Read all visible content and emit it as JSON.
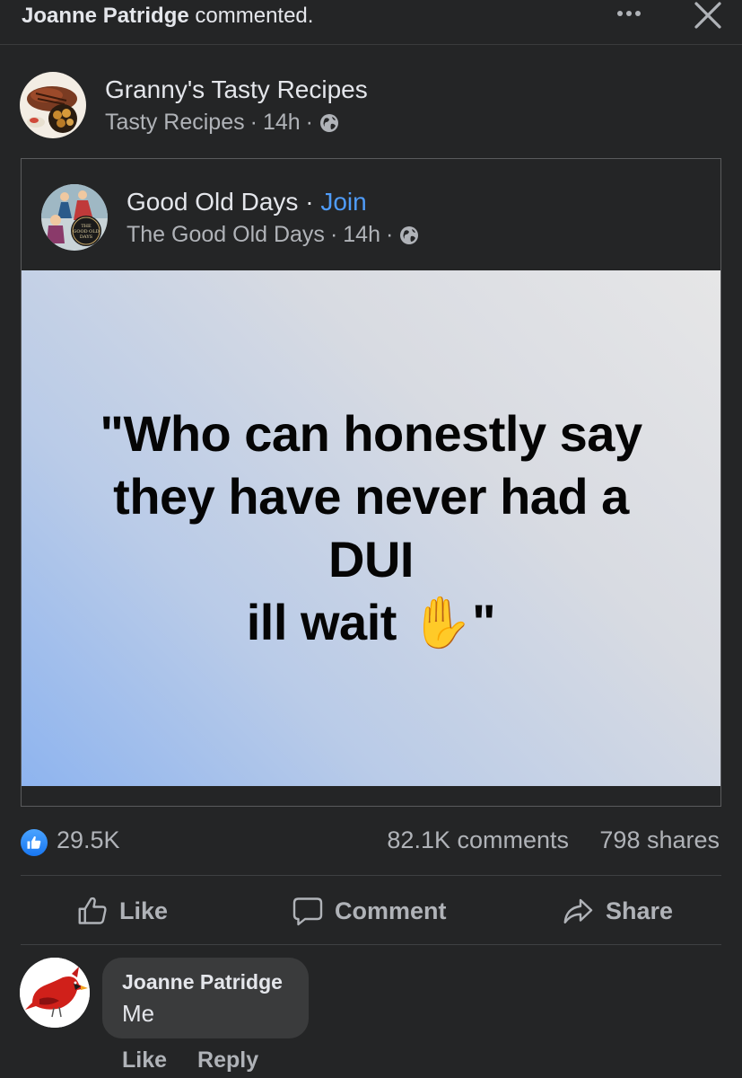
{
  "topbar": {
    "commenter": "Joanne Patridge",
    "action_text": " commented.",
    "more_icon": "more-horizontal-icon",
    "close_icon": "close-icon"
  },
  "post": {
    "page_name": "Granny's Tasty Recipes",
    "group_name": "Tasty Recipes",
    "time": "14h",
    "separator": "·",
    "privacy_icon": "globe-icon"
  },
  "shared_post": {
    "page_name": "Good Old Days",
    "separator": " · ",
    "join_label": "Join",
    "sub_name": "The Good Old Days",
    "time": "14h",
    "privacy_icon": "globe-icon",
    "avatar_text": "THE GOOD OLD DAYS",
    "quote_lines": [
      "\"Who can honestly say",
      "they have never had a",
      "DUI",
      "ill wait ✋\""
    ]
  },
  "stats": {
    "likes": "29.5K",
    "comments": "82.1K comments",
    "shares": "798 shares"
  },
  "actions": {
    "like": "Like",
    "comment": "Comment",
    "share": "Share"
  },
  "comment": {
    "author": "Joanne Patridge",
    "text": "Me",
    "like_label": "Like",
    "reply_label": "Reply"
  },
  "colors": {
    "background": "#242526",
    "text_primary": "#e4e6eb",
    "text_secondary": "#b0b3b8",
    "link_blue": "#4f9cf9",
    "like_blue": "#1877f2"
  }
}
